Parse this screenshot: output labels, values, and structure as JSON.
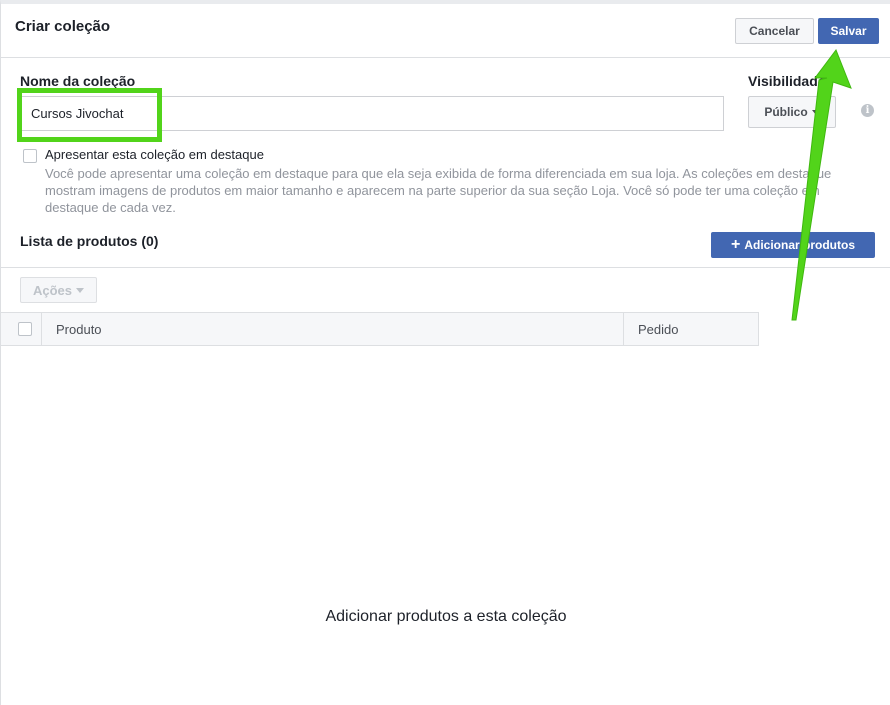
{
  "header": {
    "title": "Criar coleção",
    "cancel_label": "Cancelar",
    "save_label": "Salvar"
  },
  "form": {
    "name_label": "Nome da coleção",
    "name_value": "Cursos Jivochat",
    "visibility_label": "Visibilidade",
    "visibility_value": "Público",
    "info_glyph": "i",
    "featured_label": "Apresentar esta coleção em destaque",
    "featured_description": "Você pode apresentar uma coleção em destaque para que ela seja exibida de forma diferenciada em sua loja. As coleções em destaque mostram imagens de produtos em maior tamanho e aparecem na parte superior da sua seção Loja. Você só pode ter uma coleção em destaque de cada vez.",
    "featured_checked": false
  },
  "products": {
    "title": "Lista de produtos (0)",
    "add_label": "Adicionar produtos",
    "actions_label": "Ações",
    "columns": [
      "Produto",
      "Pedido"
    ],
    "empty_message": "Adicionar produtos a esta coleção"
  },
  "colors": {
    "accent": "#4267b2",
    "annotation": "#52d41a"
  },
  "icons": {
    "info": "info-icon",
    "plus": "plus-icon",
    "caret": "chevron-down-icon"
  }
}
